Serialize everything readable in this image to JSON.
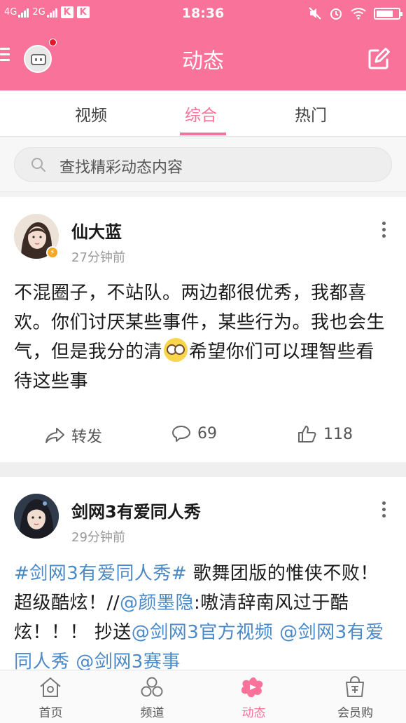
{
  "status_bar": {
    "network_1": "4G",
    "network_2": "2G",
    "badge_1": "K",
    "badge_2": "K",
    "time": "18:36",
    "battery_level": 0.75
  },
  "header": {
    "title": "动态",
    "has_notification": true
  },
  "tabs": [
    {
      "label": "视频",
      "active": false
    },
    {
      "label": "综合",
      "active": true
    },
    {
      "label": "热门",
      "active": false
    }
  ],
  "search": {
    "placeholder": "查找精彩动态内容"
  },
  "posts": [
    {
      "username": "仙大蓝",
      "time": "27分钟前",
      "verified": true,
      "text_part1": "不混圈子，不站队。两边都很优秀，我都喜欢。你们讨厌某些事件，某些行为。我也会生气，但是我分的清",
      "emoji": "flushed-face",
      "text_part2": "希望你们可以理智些看待这些事",
      "repost_label": "转发",
      "comment_count": "69",
      "like_count": "118"
    },
    {
      "username": "剑网3有爱同人秀",
      "time": "29分钟前",
      "verified": false,
      "hashtag": "#剑网3有爱同人秀#",
      "text_a": " 歌舞团版的惟侠不败！超级酷炫！//",
      "mention_1": "@颜墨隐",
      "text_b": ":嗷清辞南风过于酷炫！！！ 抄送",
      "mention_2": "@剑网3官方视频",
      "mention_3": "@剑网3有爱同人秀",
      "mention_4": "@剑网3赛事"
    }
  ],
  "bottom_nav": [
    {
      "label": "首页",
      "icon": "home-icon",
      "active": false
    },
    {
      "label": "频道",
      "icon": "channels-icon",
      "active": false
    },
    {
      "label": "动态",
      "icon": "dynamic-icon",
      "active": true
    },
    {
      "label": "会员购",
      "icon": "shop-icon",
      "active": false
    }
  ],
  "colors": {
    "brand_pink": "#f87299",
    "link_blue": "#4a89c8"
  }
}
